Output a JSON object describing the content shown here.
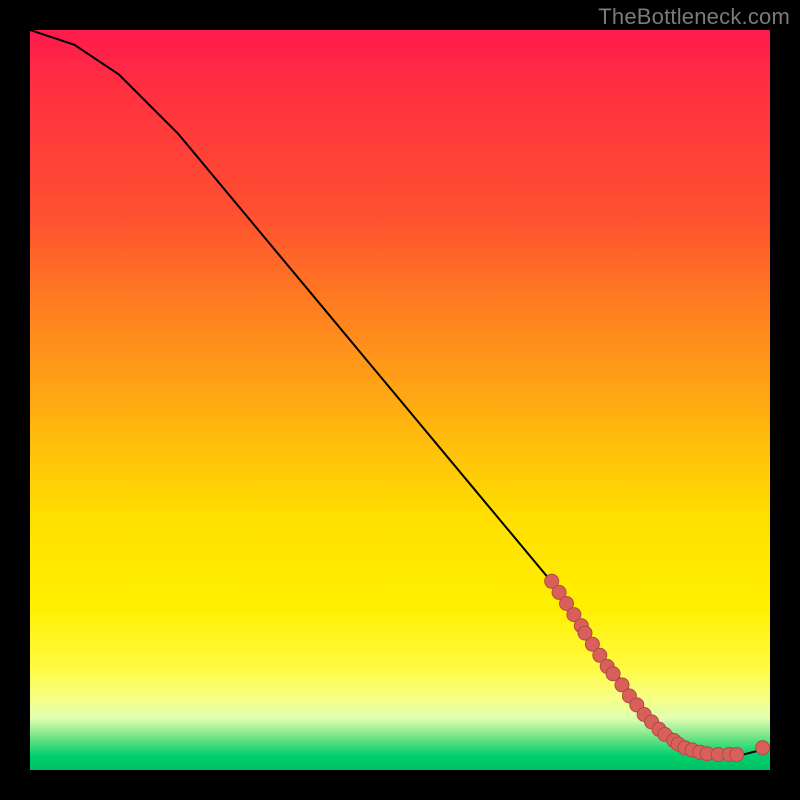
{
  "watermark": "TheBottleneck.com",
  "chart_data": {
    "type": "line",
    "title": "",
    "xlabel": "",
    "ylabel": "",
    "xlim": [
      0,
      100
    ],
    "ylim": [
      0,
      100
    ],
    "series": [
      {
        "name": "curve",
        "x": [
          0,
          6,
          12,
          20,
          30,
          40,
          50,
          60,
          70,
          76,
          80,
          84,
          88,
          92,
          96,
          100
        ],
        "y": [
          100,
          98,
          94,
          86,
          74,
          62,
          50,
          38,
          26,
          17,
          12,
          7,
          4,
          2,
          2,
          3
        ]
      }
    ],
    "scatter_points": [
      {
        "x": 70.5,
        "y": 25.5
      },
      {
        "x": 71.5,
        "y": 24.0
      },
      {
        "x": 72.5,
        "y": 22.5
      },
      {
        "x": 73.5,
        "y": 21.0
      },
      {
        "x": 74.5,
        "y": 19.5
      },
      {
        "x": 75.0,
        "y": 18.5
      },
      {
        "x": 76.0,
        "y": 17.0
      },
      {
        "x": 77.0,
        "y": 15.5
      },
      {
        "x": 78.0,
        "y": 14.0
      },
      {
        "x": 78.8,
        "y": 13.0
      },
      {
        "x": 80.0,
        "y": 11.5
      },
      {
        "x": 81.0,
        "y": 10.0
      },
      {
        "x": 82.0,
        "y": 8.8
      },
      {
        "x": 83.0,
        "y": 7.5
      },
      {
        "x": 84.0,
        "y": 6.5
      },
      {
        "x": 85.0,
        "y": 5.5
      },
      {
        "x": 85.8,
        "y": 4.8
      },
      {
        "x": 87.0,
        "y": 4.0
      },
      {
        "x": 87.6,
        "y": 3.5
      },
      {
        "x": 88.5,
        "y": 3.0
      },
      {
        "x": 89.5,
        "y": 2.7
      },
      {
        "x": 90.5,
        "y": 2.4
      },
      {
        "x": 91.5,
        "y": 2.2
      },
      {
        "x": 93.0,
        "y": 2.1
      },
      {
        "x": 94.5,
        "y": 2.1
      },
      {
        "x": 95.5,
        "y": 2.1
      },
      {
        "x": 99.0,
        "y": 3.0
      }
    ],
    "colors": {
      "curve": "#000000",
      "points_fill": "#d9605a",
      "points_stroke": "#b04a45"
    }
  }
}
